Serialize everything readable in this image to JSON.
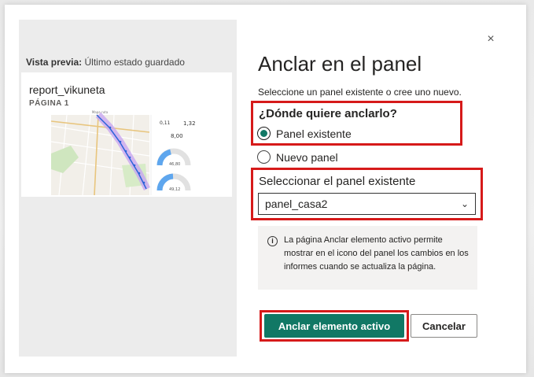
{
  "preview": {
    "caption_bold": "Vista previa:",
    "caption_rest": "Último estado guardado",
    "report_name": "report_vikuneta",
    "page_label": "PÁGINA 1",
    "thumb": {
      "map_title": "Mapa ruta",
      "stat1": "0,11",
      "stat2": "1,32",
      "stat3": "8,00",
      "gauge1": "46,80",
      "gauge2": "49,12"
    }
  },
  "dialog": {
    "title": "Anclar en el panel",
    "subtitle": "Seleccione un panel existente o cree uno nuevo.",
    "question": "¿Dónde quiere anclarlo?",
    "option_existing": "Panel existente",
    "option_new": "Nuevo panel",
    "selected_option": "Panel existente",
    "select_label": "Seleccionar el panel existente",
    "select_value": "panel_casa2",
    "info_text": "La página Anclar elemento activo permite mostrar en el icono del panel los cambios en los informes cuando se actualiza la página.",
    "primary_button": "Anclar elemento activo",
    "secondary_button": "Cancelar",
    "close_glyph": "×"
  },
  "colors": {
    "accent": "#117865",
    "highlight": "#d61a1a",
    "info_bg": "#f3f2f1"
  },
  "icons": [
    "close-icon",
    "radio-selected-icon",
    "radio-empty-icon",
    "chevron-down-icon",
    "info-icon"
  ]
}
